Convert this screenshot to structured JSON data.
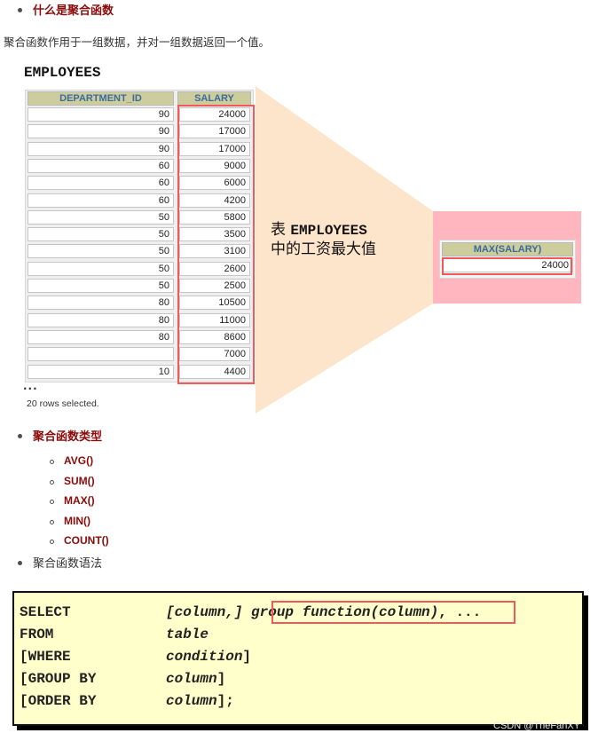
{
  "section1": {
    "heading": "什么是聚合函数",
    "description": "聚合函数作用于一组数据，并对一组数据返回一个值。"
  },
  "figure": {
    "table_title": "EMPLOYEES",
    "columns": [
      "DEPARTMENT_ID",
      "SALARY"
    ],
    "rows": [
      [
        "90",
        "24000"
      ],
      [
        "90",
        "17000"
      ],
      [
        "90",
        "17000"
      ],
      [
        "60",
        "9000"
      ],
      [
        "60",
        "6000"
      ],
      [
        "60",
        "4200"
      ],
      [
        "50",
        "5800"
      ],
      [
        "50",
        "3500"
      ],
      [
        "50",
        "3100"
      ],
      [
        "50",
        "2600"
      ],
      [
        "50",
        "2500"
      ],
      [
        "80",
        "10500"
      ],
      [
        "80",
        "11000"
      ],
      [
        "80",
        "8600"
      ],
      [
        "",
        "7000"
      ],
      [
        "10",
        "4400"
      ]
    ],
    "ellipsis": "...",
    "rows_selected": "20 rows selected.",
    "callout_line1_prefix": "表",
    "callout_line1_mono": "EMPLOYEES",
    "callout_line2": "中的工资最大值",
    "result_column": "MAX(SALARY)",
    "result_value": "24000",
    "colors": {
      "wedge": "#fde5cc",
      "result_bg": "#ffb6be",
      "highlight": "#f05a5a",
      "header_bg": "#cdcc9c",
      "header_text": "#3a6b9c"
    }
  },
  "section2": {
    "heading": "聚合函数类型",
    "functions": [
      "AVG()",
      "SUM()",
      "MAX()",
      "MIN()",
      "COUNT()"
    ]
  },
  "section3": {
    "heading": "聚合函数语法"
  },
  "syntax": {
    "lines": [
      {
        "kw": "SELECT",
        "arg_pre": "[column,] ",
        "arg_hl": "group function(column)",
        "arg_post": ", ..."
      },
      {
        "kw": "FROM",
        "arg": "table",
        "suffix": ""
      },
      {
        "kw": "[WHERE",
        "arg": "condition",
        "suffix": "]"
      },
      {
        "kw": "[GROUP BY",
        "arg": "column",
        "suffix": "]"
      },
      {
        "kw": "[ORDER BY",
        "arg": "column",
        "suffix": "];"
      }
    ]
  },
  "watermark": "CSDN @TheFanXY"
}
